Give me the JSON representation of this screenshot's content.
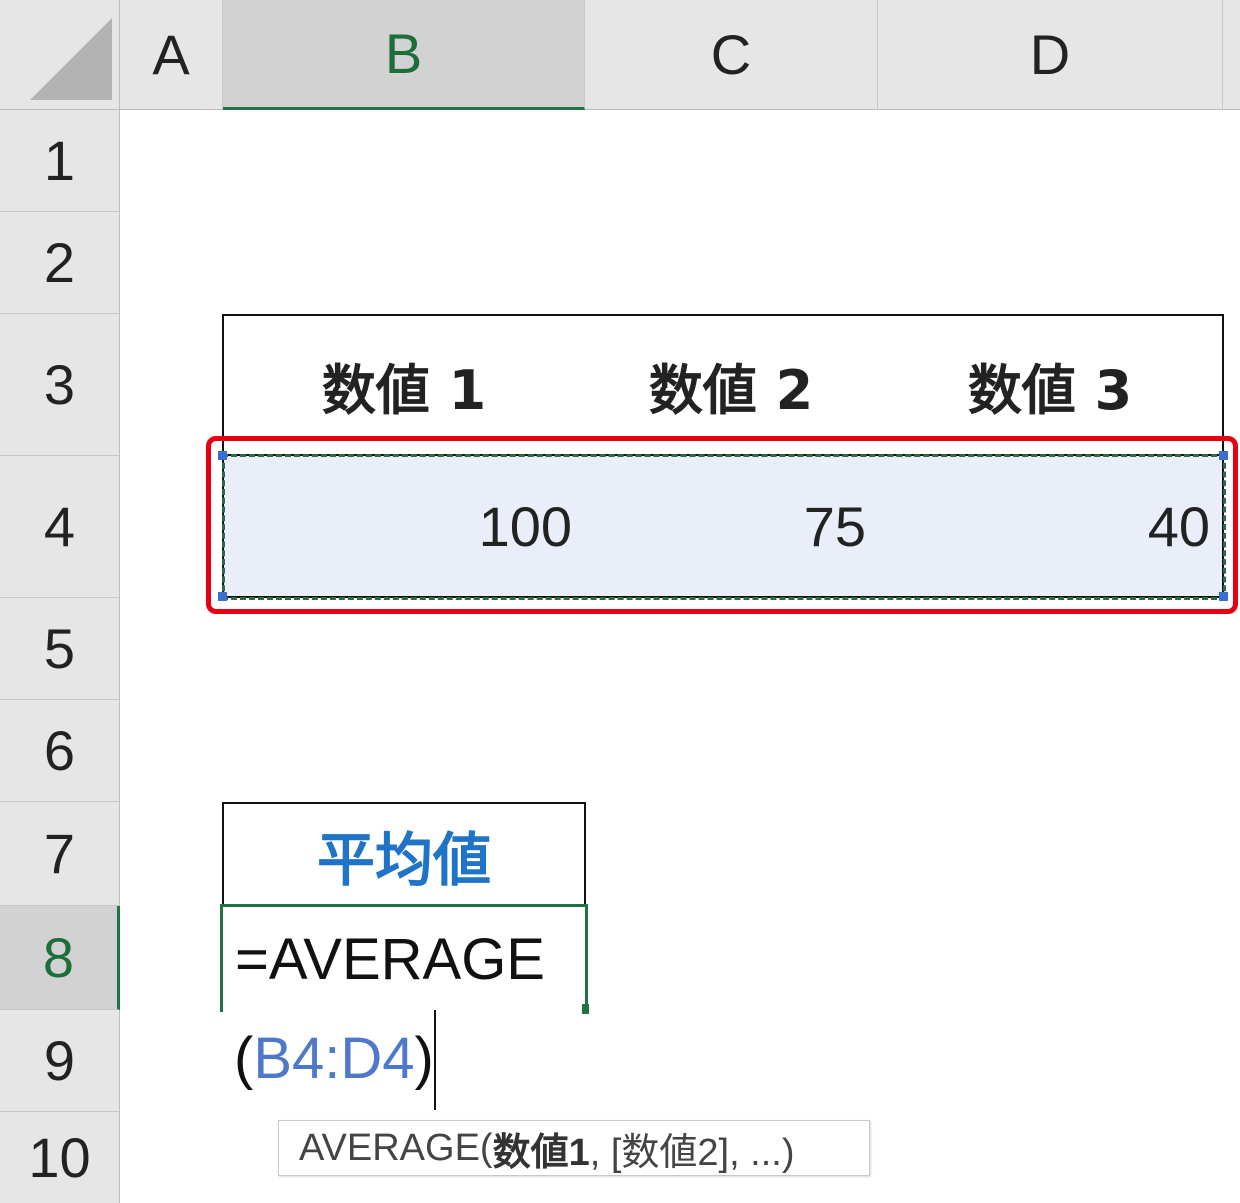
{
  "columns": [
    "A",
    "B",
    "C",
    "D"
  ],
  "rows": [
    "1",
    "2",
    "3",
    "4",
    "5",
    "6",
    "7",
    "8",
    "9",
    "10"
  ],
  "selected_column": "B",
  "selected_row": "8",
  "table": {
    "headers": [
      "数値 1",
      "数値 2",
      "数値 3"
    ],
    "values": [
      "100",
      "75",
      "40"
    ]
  },
  "average_block": {
    "header": "平均値",
    "formula_line1": "=AVERAGE",
    "formula_open_paren": "(",
    "formula_ref": "B4:D4",
    "formula_close_paren": ")"
  },
  "tooltip": {
    "func": "AVERAGE(",
    "arg1": "数値1",
    "rest": ", [数値2], ...)"
  },
  "colors": {
    "highlight_box": "#e60012",
    "selection_green": "#217346",
    "ref_blue": "#4e78c9",
    "header_blue": "#1f74c8"
  }
}
